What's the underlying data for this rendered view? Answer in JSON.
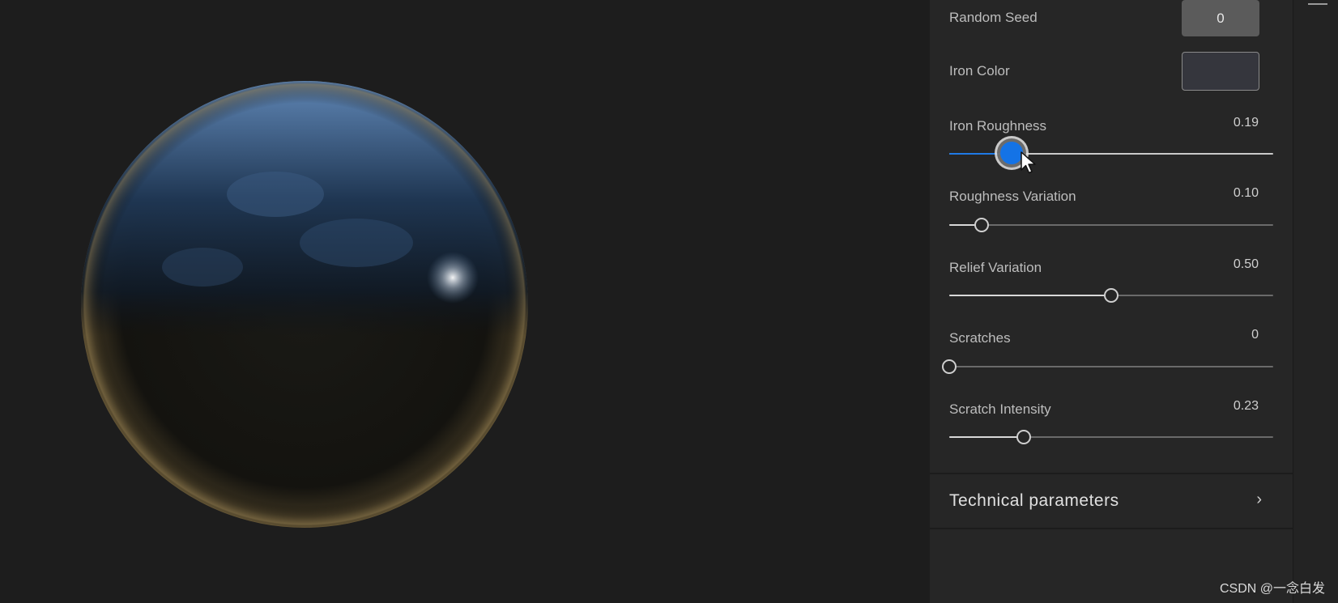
{
  "panel": {
    "random_seed": {
      "label": "Random Seed",
      "value": "0"
    },
    "iron_color": {
      "label": "Iron Color",
      "swatch": "#35363d"
    },
    "sliders": [
      {
        "label": "Iron  Roughness",
        "value": "0.19",
        "level": 0.19,
        "active": true
      },
      {
        "label": "Roughness Variation",
        "value": "0.10",
        "level": 0.1
      },
      {
        "label": "Relief Variation",
        "value": "0.50",
        "level": 0.5
      },
      {
        "label": "Scratches",
        "value": "0",
        "level": 0
      },
      {
        "label": "Scratch Intensity",
        "value": "0.23",
        "level": 0.23
      }
    ],
    "technical_section": {
      "label": "Technical parameters",
      "icon": "chevron-right-icon"
    }
  },
  "watermark": "CSDN @一念白发",
  "colors": {
    "accent": "#1473e6",
    "panel_bg": "#262626",
    "viewport_bg": "#1d1d1d"
  }
}
